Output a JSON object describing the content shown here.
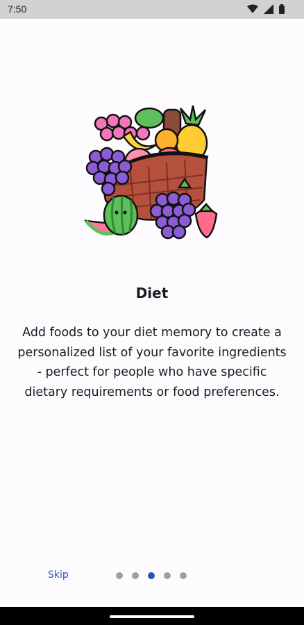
{
  "status_bar": {
    "time": "7:50",
    "icons": [
      "wifi-icon",
      "signal-icon",
      "battery-icon"
    ]
  },
  "onboarding": {
    "illustration": "fruit-basket-illustration",
    "title": "Diet",
    "description": "Add foods to your diet memory to create a personalized list of your favorite ingredients - perfect for people who have specific dietary requirements or food preferences.",
    "skip_label": "Skip",
    "page_count": 5,
    "current_page": 3
  },
  "colors": {
    "accent": "#2a52b8",
    "dot_inactive": "#9e9e9e",
    "background": "#fefbff"
  }
}
